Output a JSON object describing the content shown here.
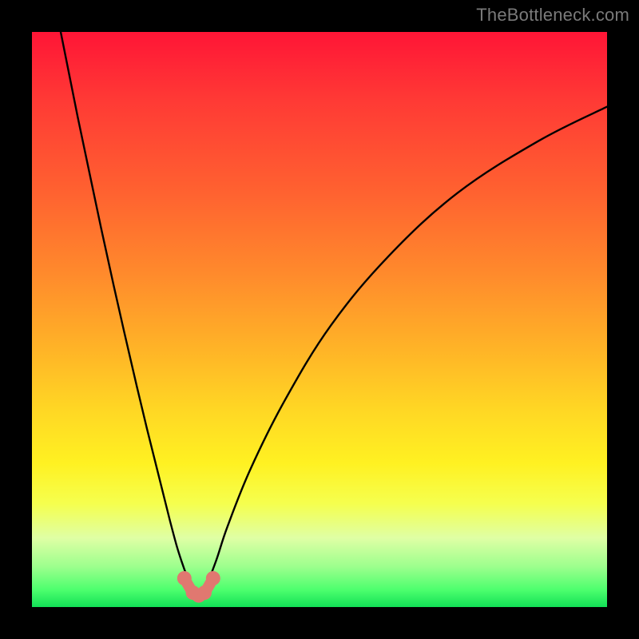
{
  "watermark": "TheBottleneck.com",
  "colors": {
    "frame": "#000000",
    "curve": "#000000",
    "marker": "#e07870",
    "gradient_top": "#ff1536",
    "gradient_bottom": "#12e056"
  },
  "chart_data": {
    "type": "line",
    "title": "",
    "xlabel": "",
    "ylabel": "",
    "xlim": [
      0,
      100
    ],
    "ylim": [
      0,
      100
    ],
    "notes": "V-shaped bottleneck curve on rainbow gradient; minimum near x≈29 at y≈2. Salmon highlight marks the trough region.",
    "series": [
      {
        "name": "bottleneck-curve",
        "x": [
          5,
          8,
          12,
          16,
          20,
          24,
          26,
          28,
          29,
          30,
          32,
          34,
          38,
          44,
          52,
          62,
          74,
          88,
          100
        ],
        "y": [
          100,
          85,
          66,
          48,
          31,
          15,
          8,
          3,
          2,
          3,
          8,
          14,
          24,
          36,
          49,
          61,
          72,
          81,
          87
        ]
      }
    ],
    "highlight": {
      "name": "trough-marker",
      "x": [
        26.5,
        28,
        29,
        30,
        31.5
      ],
      "y": [
        5,
        2.5,
        2,
        2.5,
        5
      ]
    }
  }
}
